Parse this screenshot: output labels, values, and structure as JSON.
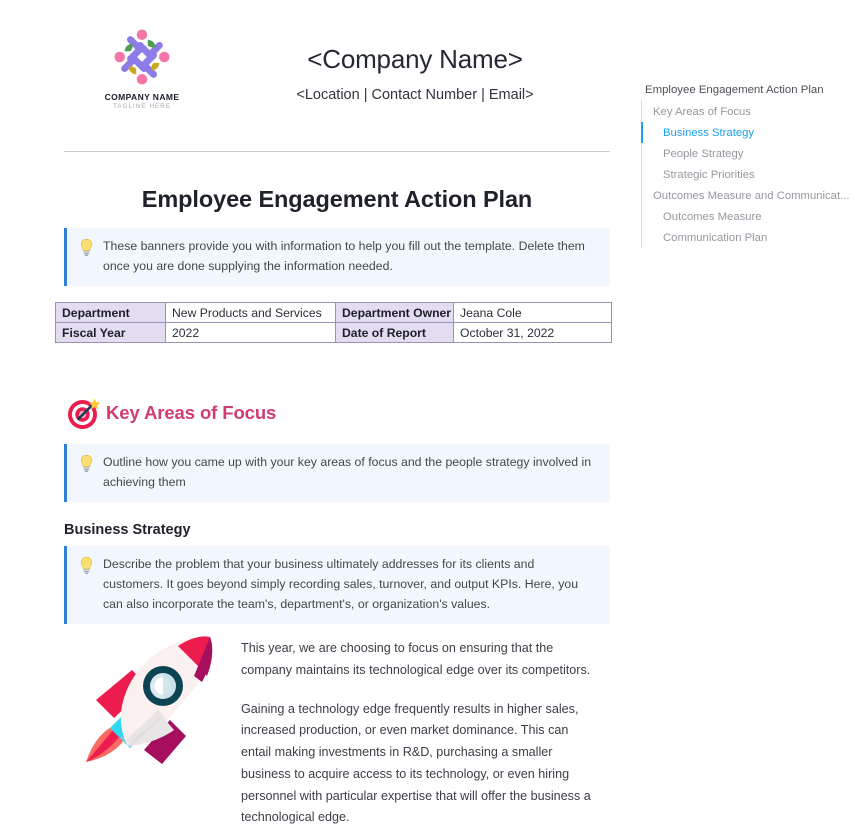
{
  "header": {
    "logo": {
      "name": "COMPANY NAME",
      "tagline": "TAGLINE HERE",
      "icon": "people-pinwheel-logo-icon"
    },
    "company_name": "<Company Name>",
    "company_meta": "<Location | Contact Number | Email>"
  },
  "document": {
    "title": "Employee Engagement Action Plan"
  },
  "banners": {
    "intro": {
      "icon": "lightbulb-icon",
      "text": "These banners provide you with information to help you fill out the template. Delete them once you are done supplying the information needed."
    },
    "focus": {
      "icon": "lightbulb-icon",
      "text": "Outline how you came up with your key areas of focus and the people strategy involved in achieving them"
    },
    "business": {
      "icon": "lightbulb-icon",
      "text": "Describe the problem that your business ultimately addresses for its clients and customers. It goes beyond simply recording sales, turnover, and output KPIs. Here, you can also incorporate the team's, department's, or organization's values."
    }
  },
  "info_table": {
    "rows": [
      {
        "label1": "Department",
        "value1": "New Products and Services",
        "label2": "Department Owner",
        "value2": "Jeana Cole"
      },
      {
        "label1": "Fiscal Year",
        "value1": "2022",
        "label2": "Date of Report",
        "value2": "October 31, 2022"
      }
    ]
  },
  "sections": {
    "key_areas": {
      "icon": "target-dart-icon",
      "heading": "Key Areas of Focus",
      "color": "#d23c72"
    },
    "business_strategy": {
      "heading": "Business Strategy",
      "illustration": "rocket-icon",
      "paragraphs": {
        "p1": "This year, we are choosing to focus on ensuring that the company maintains its technological edge over its competitors.",
        "p2": "Gaining a technology edge frequently results in higher sales, increased production, or even market dominance. This can entail making investments in R&D, purchasing a smaller business to acquire access to its technology, or even hiring personnel with particular expertise that will offer the business a technological edge."
      }
    }
  },
  "navigation": {
    "title": "Employee Engagement Action Plan",
    "active_color": "#1ca0f0",
    "items": [
      {
        "label": "Key Areas of Focus",
        "level": 1,
        "active": false
      },
      {
        "label": "Business Strategy",
        "level": 2,
        "active": true
      },
      {
        "label": "People Strategy",
        "level": 2,
        "active": false
      },
      {
        "label": "Strategic Priorities",
        "level": 2,
        "active": false
      },
      {
        "label": "Outcomes Measure and Communicat...",
        "level": 1,
        "active": false
      },
      {
        "label": "Outcomes Measure",
        "level": 2,
        "active": false
      },
      {
        "label": "Communication Plan",
        "level": 2,
        "active": false
      }
    ]
  }
}
